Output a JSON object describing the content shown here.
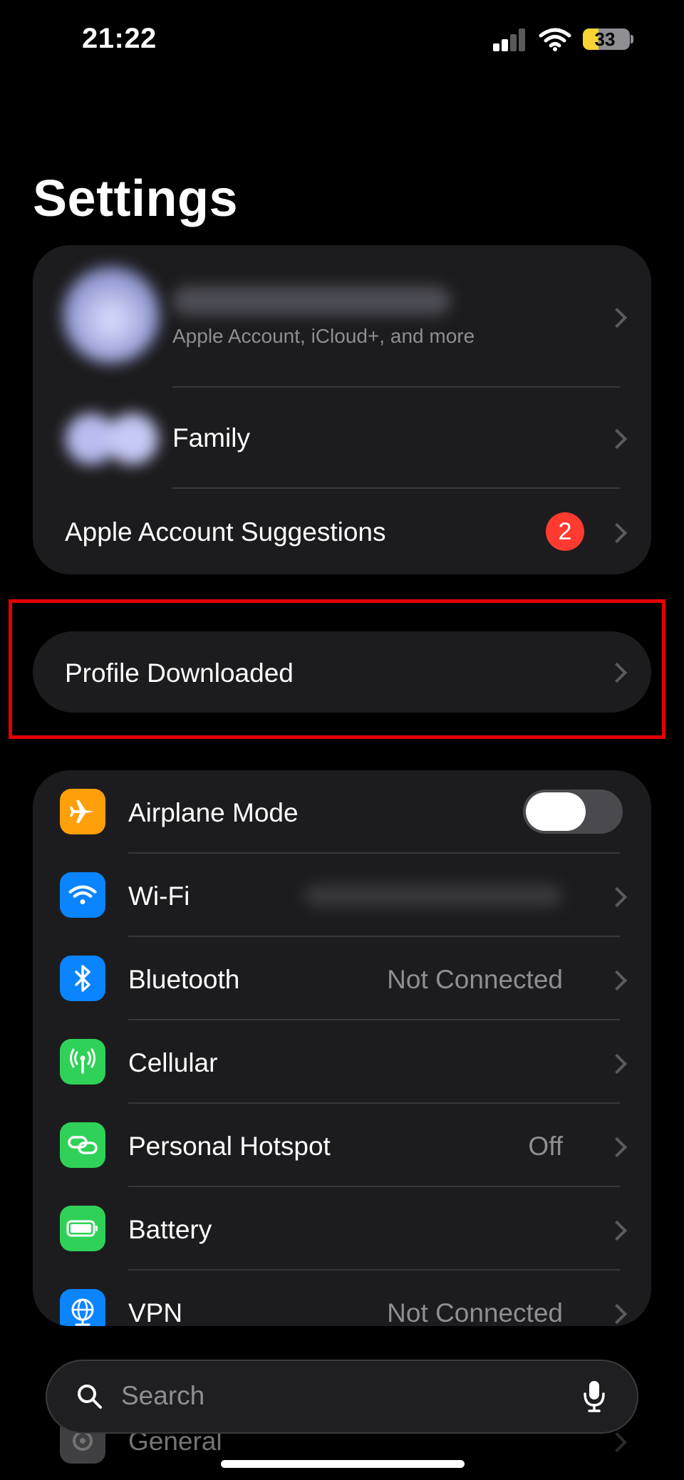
{
  "status_bar": {
    "time": "21:22",
    "battery_percent": "33",
    "battery_level": 0.33,
    "icons": [
      "cellular-signal-icon",
      "wifi-icon",
      "battery-charging-icon"
    ]
  },
  "page": {
    "title": "Settings"
  },
  "account_card": {
    "account_subtitle": "Apple Account, iCloud+, and more",
    "family_label": "Family",
    "suggestions_label": "Apple Account Suggestions",
    "suggestions_badge": "2"
  },
  "profile_card": {
    "label": "Profile Downloaded"
  },
  "settings_list": [
    {
      "label": "Airplane Mode",
      "icon": "airplane-icon",
      "color": "#ff9f0a",
      "toggle": false
    },
    {
      "label": "Wi-Fi",
      "icon": "wifi-icon",
      "color": "#0a84ff",
      "value": ""
    },
    {
      "label": "Bluetooth",
      "icon": "bluetooth-icon",
      "color": "#0a84ff",
      "value": "Not Connected"
    },
    {
      "label": "Cellular",
      "icon": "antenna-icon",
      "color": "#30d158",
      "value": ""
    },
    {
      "label": "Personal Hotspot",
      "icon": "hotspot-link-icon",
      "color": "#30d158",
      "value": "Off"
    },
    {
      "label": "Battery",
      "icon": "battery-icon",
      "color": "#30d158",
      "value": ""
    },
    {
      "label": "VPN",
      "icon": "globe-icon",
      "color": "#0a84ff",
      "value": "Not Connected"
    },
    {
      "label": "General",
      "icon": "gear-icon",
      "color": "#8e8e93",
      "value": ""
    }
  ],
  "search": {
    "placeholder": "Search"
  },
  "colors": {
    "accent_blue": "#0a84ff",
    "badge_red": "#ff3b30",
    "highlight_red": "#e30000"
  }
}
